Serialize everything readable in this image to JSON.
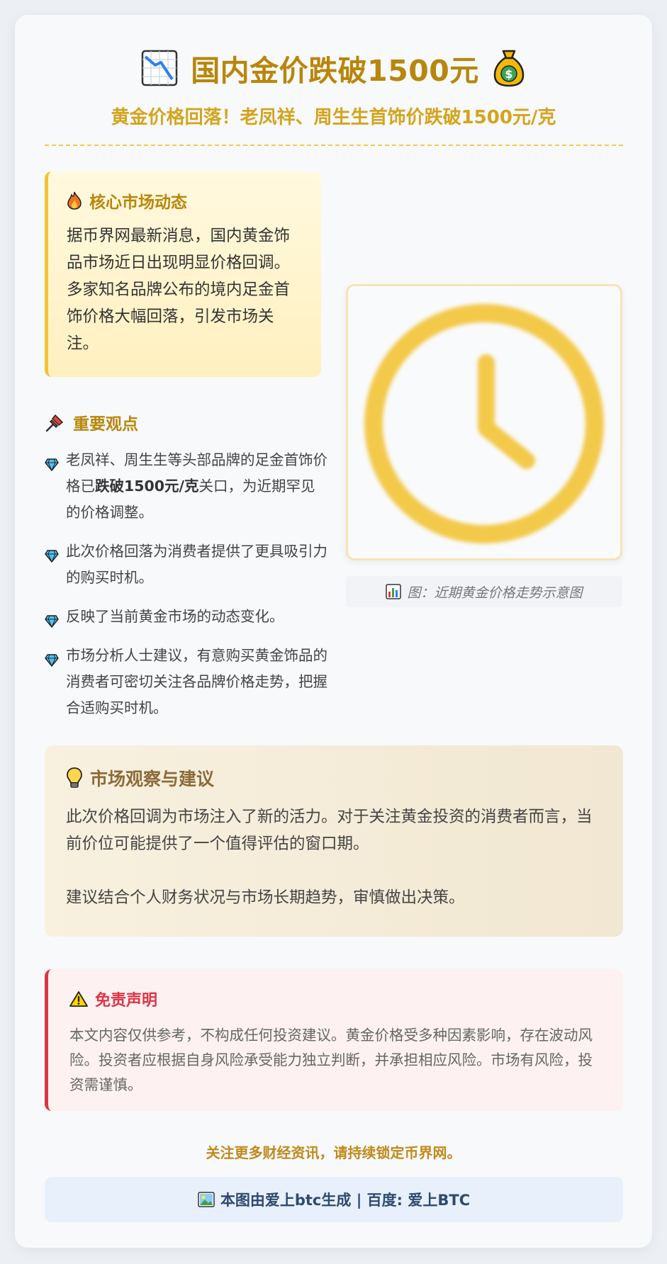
{
  "header": {
    "title": "国内金价跌破1500元",
    "subtitle": "黄金价格回落！老凤祥、周生生首饰价跌破1500元/克",
    "left_icon": "chart-down-icon",
    "right_icon": "money-bag-icon"
  },
  "core": {
    "icon": "fire-icon",
    "title": "核心市场动态",
    "text": "据币界网最新消息，国内黄金饰品市场近日出现明显价格回调。多家知名品牌公布的境内足金首饰价格大幅回落，引发市场关注。"
  },
  "points": {
    "icon": "pushpin-icon",
    "title": "重要观点",
    "items": [
      {
        "pre": "老凤祥、周生生等头部品牌的足金首饰价格已",
        "bold": "跌破1500元/克",
        "post": "关口，为近期罕见的价格调整。"
      },
      {
        "pre": "此次价格回落为消费者提供了更具吸引力的购买时机。",
        "bold": "",
        "post": ""
      },
      {
        "pre": "反映了当前黄金市场的动态变化。",
        "bold": "",
        "post": ""
      },
      {
        "pre": "市场分析人士建议，有意购买黄金饰品的消费者可密切关注各品牌价格走势，把握合适购买时机。",
        "bold": "",
        "post": ""
      }
    ]
  },
  "image": {
    "icon": "clock-icon",
    "caption": "图：近期黄金价格走势示意图",
    "caption_icon": "bar-chart-icon"
  },
  "observation": {
    "icon": "lightbulb-icon",
    "title": "市场观察与建议",
    "p1": "此次价格回调为市场注入了新的活力。对于关注黄金投资的消费者而言，当前价位可能提供了一个值得评估的窗口期。",
    "p2": "建议结合个人财务状况与市场长期趋势，审慎做出决策。"
  },
  "disclaimer": {
    "icon": "warning-icon",
    "title": "免责声明",
    "text": "本文内容仅供参考，不构成任何投资建议。黄金价格受多种因素影响，存在波动风险。投资者应根据自身风险承受能力独立判断，并承担相应风险。市场有风险，投资需谨慎。"
  },
  "footer": {
    "note": "关注更多财经资讯，请持续锁定币界网。",
    "credit": "本图由爱上btc生成 | 百度: 爱上BTC",
    "credit_icon": "picture-icon"
  },
  "colors": {
    "accent": "#b8860b",
    "subtitle": "#d4a41d",
    "danger": "#dc3545",
    "clock": "#f3c94a"
  }
}
